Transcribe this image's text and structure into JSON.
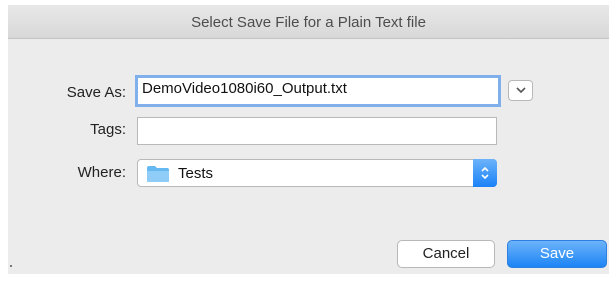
{
  "window": {
    "title": "Select Save File for a Plain Text file"
  },
  "form": {
    "save_as_label": "Save As:",
    "save_as_value": "DemoVideo1080i60_Output.txt",
    "tags_label": "Tags:",
    "tags_value": "",
    "where_label": "Where:",
    "where_value": "Tests",
    "where_icon": "folder-icon"
  },
  "buttons": {
    "cancel": "Cancel",
    "save": "Save"
  },
  "colors": {
    "accent": "#1a82f7",
    "focus_ring": "#7fb0ec",
    "dialog_bg": "#ececec"
  }
}
